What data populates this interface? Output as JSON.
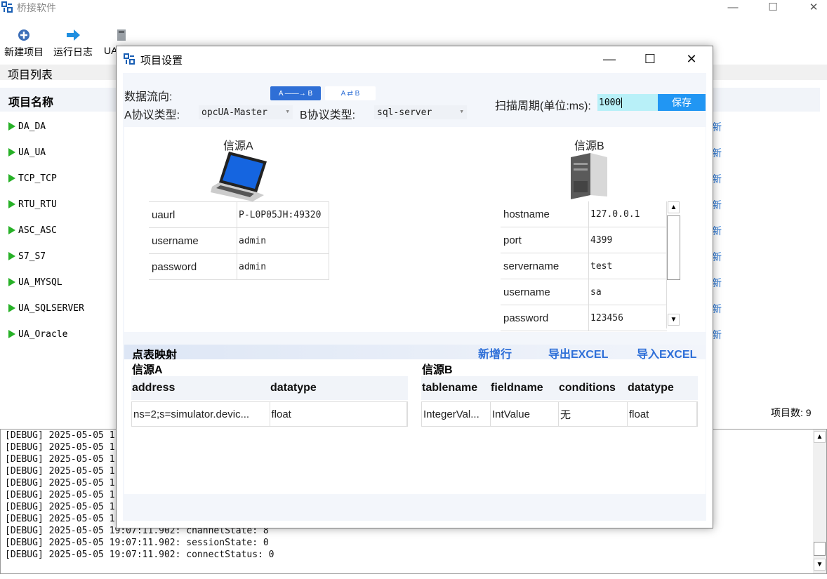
{
  "main_window": {
    "title": "桥接软件",
    "controls": {
      "minimize": "—",
      "maximize": "☐",
      "close": "✕"
    }
  },
  "toolbar": {
    "new_project": "新建项目",
    "run_log": "运行日志",
    "ua": "UA"
  },
  "project_list": {
    "title": "项目列表",
    "column_name": "项目名称",
    "items": [
      "DA_DA",
      "UA_UA",
      "TCP_TCP",
      "RTU_RTU",
      "ASC_ASC",
      "S7_S7",
      "UA_MYSQL",
      "UA_SQLSERVER",
      "UA_Oracle"
    ],
    "row_action": "新",
    "count_label": "项目数: 9"
  },
  "log": {
    "lines": [
      "[DEBUG] 2025-05-05 1",
      "[DEBUG] 2025-05-05 1",
      "[DEBUG] 2025-05-05 1",
      "[DEBUG] 2025-05-05 1",
      "[DEBUG] 2025-05-05 1",
      "[DEBUG] 2025-05-05 1",
      "[DEBUG] 2025-05-05 1",
      "[DEBUG] 2025-05-05 1",
      "[DEBUG] 2025-05-05 19:07:11.902: channelState: 8",
      "[DEBUG] 2025-05-05 19:07:11.902: sessionState: 0",
      "[DEBUG] 2025-05-05 19:07:11.902: connectStatus: 0"
    ]
  },
  "dialog": {
    "title": "项目设置",
    "data_flow_label": "数据流向:",
    "flow_a_to_b": "A ——→ B",
    "flow_bidirectional": "A ⇄ B",
    "a_protocol_label": "A协议类型:",
    "a_protocol_value": "opcUA-Master",
    "b_protocol_label": "B协议类型:",
    "b_protocol_value": "sql-server",
    "scan_label": "扫描周期(单位:ms):",
    "scan_value": "1000",
    "save_label": "保存",
    "source_a": {
      "title": "信源A",
      "fields": [
        {
          "key": "uaurl",
          "value": "P-L0P05JH:49320"
        },
        {
          "key": "username",
          "value": "admin"
        },
        {
          "key": "password",
          "value": "admin"
        }
      ]
    },
    "source_b": {
      "title": "信源B",
      "fields": [
        {
          "key": "hostname",
          "value": "127.0.0.1"
        },
        {
          "key": "port",
          "value": "4399"
        },
        {
          "key": "servername",
          "value": "test"
        },
        {
          "key": "username",
          "value": "sa"
        },
        {
          "key": "password",
          "value": "123456"
        }
      ]
    },
    "mapping": {
      "title": "点表映射",
      "add_row": "新增行",
      "export_excel": "导出EXCEL",
      "import_excel": "导入EXCEL",
      "grid_a": {
        "title": "信源A",
        "headers": [
          "address",
          "datatype"
        ],
        "rows": [
          [
            "ns=2;s=simulator.devic...",
            "float"
          ]
        ]
      },
      "grid_b": {
        "title": "信源B",
        "headers": [
          "tablename",
          "fieldname",
          "conditions",
          "datatype"
        ],
        "rows": [
          [
            "IntegerVal...",
            "IntValue",
            "无",
            "float"
          ]
        ]
      }
    },
    "controls": {
      "minimize": "—",
      "maximize": "☐",
      "close": "✕"
    }
  },
  "colors": {
    "accent": "#2196f3",
    "link": "#2e6fd8",
    "play": "#27b127"
  }
}
